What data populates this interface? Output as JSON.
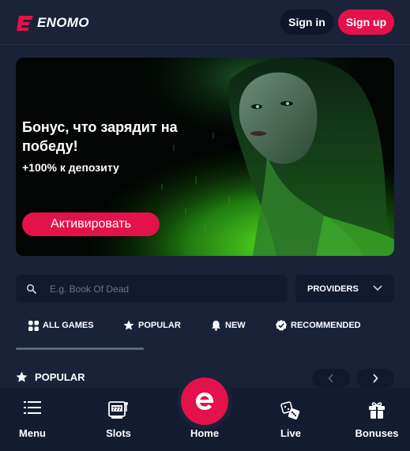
{
  "header": {
    "logo_text": "ENOMO",
    "signin_label": "Sign in",
    "signup_label": "Sign up"
  },
  "banner": {
    "title": "Бонус, что зарядит на победу!",
    "subtitle": "+100% к депозиту",
    "button_label": "Активировать"
  },
  "search": {
    "placeholder": "E.g. Book Of Dead",
    "value": ""
  },
  "providers": {
    "label": "PROVIDERS"
  },
  "tabs": [
    {
      "label": "ALL GAMES",
      "icon": "grid-icon"
    },
    {
      "label": "POPULAR",
      "icon": "star-icon"
    },
    {
      "label": "NEW",
      "icon": "bell-icon"
    },
    {
      "label": "RECOMMENDED",
      "icon": "badge-check-icon"
    }
  ],
  "section": {
    "title": "POPULAR"
  },
  "bottom_nav": [
    {
      "label": "Menu",
      "icon": "hamburger-icon"
    },
    {
      "label": "Slots",
      "icon": "slot-machine-icon"
    },
    {
      "label": "Home",
      "icon": "logo-e-icon"
    },
    {
      "label": "Live",
      "icon": "dice-icon"
    },
    {
      "label": "Bonuses",
      "icon": "gift-icon"
    }
  ],
  "colors": {
    "background": "#1a2238",
    "accent": "#e3124a",
    "dark_panel": "#121a2e"
  }
}
